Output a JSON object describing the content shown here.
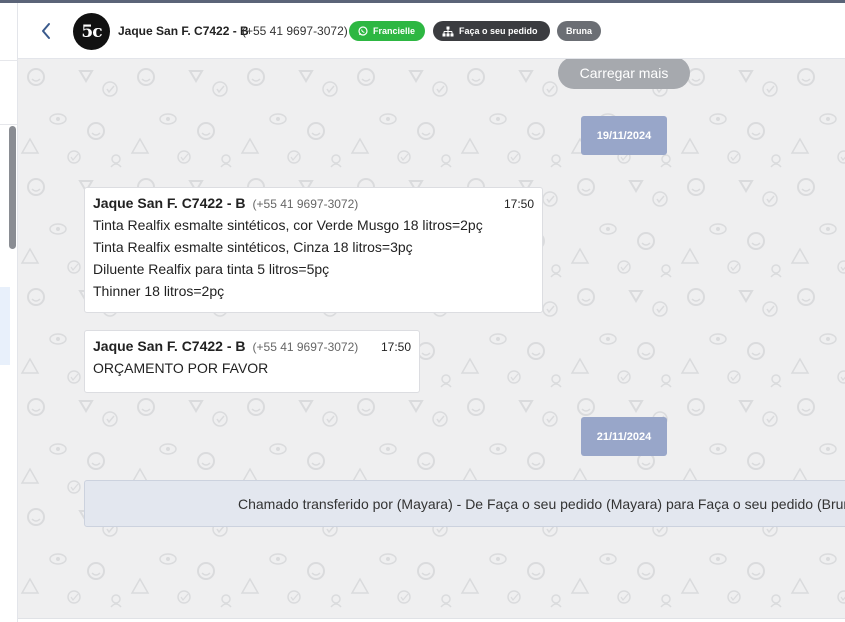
{
  "header": {
    "contact_name": "Jaque San F. C7422 - B",
    "contact_phone": "(+55 41 9697-3072)",
    "avatar_text": "5c",
    "tags": [
      {
        "label": "Francielle",
        "icon": "whatsapp-icon",
        "color": "#2db742"
      },
      {
        "label": "Faça o seu pedido",
        "icon": "org-chart-icon",
        "color": "#3b3c40"
      },
      {
        "label": "Bruna",
        "color": "#6b6e74"
      }
    ]
  },
  "chat": {
    "load_more_label": "Carregar mais",
    "dates": [
      "19/11/2024",
      "21/11/2024"
    ],
    "messages": [
      {
        "sender": "Jaque San F. C7422 - B",
        "phone": "(+55 41 9697-3072)",
        "time": "17:50",
        "lines": [
          "Tinta Realfix esmalte sintéticos, cor Verde Musgo 18 litros=2pç",
          "Tinta Realfix esmalte sintéticos, Cinza 18 litros=3pç",
          "Diluente Realfix para tinta 5 litros=5pç",
          "Thinner 18 litros=2pç"
        ]
      },
      {
        "sender": "Jaque San F. C7422 - B",
        "phone": "(+55 41 9697-3072)",
        "time": "17:50",
        "lines": [
          "ORÇAMENTO POR FAVOR"
        ]
      }
    ],
    "system_message": "Chamado transferido por (Mayara) - De Faça o seu pedido (Mayara) para Faça o seu pedido (Bruna)"
  },
  "colors": {
    "date_chip": "#98a6c9",
    "whatsapp_tag": "#2db742",
    "chat_background": "#efeff0"
  }
}
